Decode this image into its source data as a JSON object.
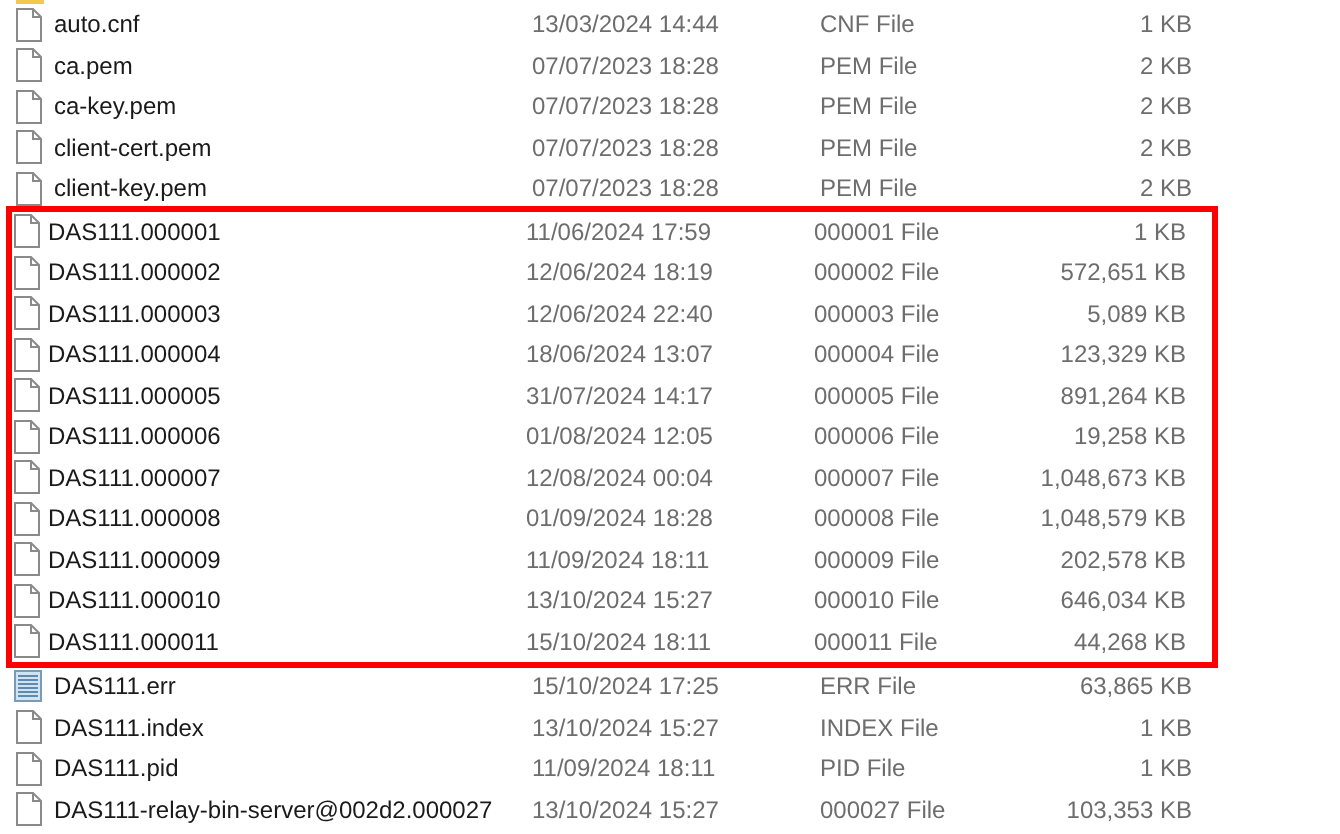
{
  "files_before": [
    {
      "name": "auto.cnf",
      "modified": "13/03/2024 14:44",
      "type": "CNF File",
      "size": "1 KB",
      "kind": "file"
    },
    {
      "name": "ca.pem",
      "modified": "07/07/2023 18:28",
      "type": "PEM File",
      "size": "2 KB",
      "kind": "file"
    },
    {
      "name": "ca-key.pem",
      "modified": "07/07/2023 18:28",
      "type": "PEM File",
      "size": "2 KB",
      "kind": "file"
    },
    {
      "name": "client-cert.pem",
      "modified": "07/07/2023 18:28",
      "type": "PEM File",
      "size": "2 KB",
      "kind": "file"
    },
    {
      "name": "client-key.pem",
      "modified": "07/07/2023 18:28",
      "type": "PEM File",
      "size": "2 KB",
      "kind": "file"
    }
  ],
  "highlighted_files": [
    {
      "name": "DAS111.000001",
      "modified": "11/06/2024 17:59",
      "type": "000001 File",
      "size": "1 KB",
      "kind": "file"
    },
    {
      "name": "DAS111.000002",
      "modified": "12/06/2024 18:19",
      "type": "000002 File",
      "size": "572,651 KB",
      "kind": "file"
    },
    {
      "name": "DAS111.000003",
      "modified": "12/06/2024 22:40",
      "type": "000003 File",
      "size": "5,089 KB",
      "kind": "file"
    },
    {
      "name": "DAS111.000004",
      "modified": "18/06/2024 13:07",
      "type": "000004 File",
      "size": "123,329 KB",
      "kind": "file"
    },
    {
      "name": "DAS111.000005",
      "modified": "31/07/2024 14:17",
      "type": "000005 File",
      "size": "891,264 KB",
      "kind": "file"
    },
    {
      "name": "DAS111.000006",
      "modified": "01/08/2024 12:05",
      "type": "000006 File",
      "size": "19,258 KB",
      "kind": "file"
    },
    {
      "name": "DAS111.000007",
      "modified": "12/08/2024 00:04",
      "type": "000007 File",
      "size": "1,048,673 KB",
      "kind": "file"
    },
    {
      "name": "DAS111.000008",
      "modified": "01/09/2024 18:28",
      "type": "000008 File",
      "size": "1,048,579 KB",
      "kind": "file"
    },
    {
      "name": "DAS111.000009",
      "modified": "11/09/2024 18:11",
      "type": "000009 File",
      "size": "202,578 KB",
      "kind": "file"
    },
    {
      "name": "DAS111.000010",
      "modified": "13/10/2024 15:27",
      "type": "000010 File",
      "size": "646,034 KB",
      "kind": "file"
    },
    {
      "name": "DAS111.000011",
      "modified": "15/10/2024 18:11",
      "type": "000011 File",
      "size": "44,268 KB",
      "kind": "file"
    }
  ],
  "files_after": [
    {
      "name": "DAS111.err",
      "modified": "15/10/2024 17:25",
      "type": "ERR File",
      "size": "63,865 KB",
      "kind": "text"
    },
    {
      "name": "DAS111.index",
      "modified": "13/10/2024 15:27",
      "type": "INDEX File",
      "size": "1 KB",
      "kind": "file"
    },
    {
      "name": "DAS111.pid",
      "modified": "11/09/2024 18:11",
      "type": "PID File",
      "size": "1 KB",
      "kind": "file"
    },
    {
      "name": "DAS111-relay-bin-server@002d2.000027",
      "modified": "13/10/2024 15:27",
      "type": "000027 File",
      "size": "103,353 KB",
      "kind": "file"
    }
  ]
}
